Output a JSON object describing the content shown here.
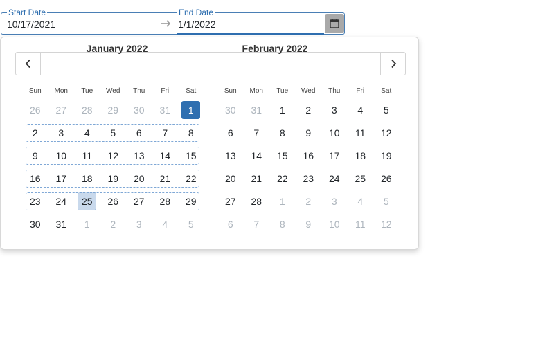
{
  "range_input": {
    "start_label": "Start Date",
    "start_value": "10/17/2021",
    "end_label": "End Date",
    "end_value": "1/1/2022"
  },
  "colors": {
    "accent": "#2f6fb0",
    "range_border": "#7fa8d6",
    "hover_fill": "#c9d9ec",
    "calendar_button": "#a9a9a9",
    "muted_day": "#adb5bd"
  },
  "icons": {
    "separator": "arrow-right-icon",
    "calendar": "calendar-icon",
    "prev": "chevron-left-icon",
    "next": "chevron-right-icon"
  },
  "calendar": {
    "weekdays": [
      "Sun",
      "Mon",
      "Tue",
      "Wed",
      "Thu",
      "Fri",
      "Sat"
    ],
    "months": [
      {
        "title": "January 2022",
        "weeks": [
          {
            "in_range": false,
            "days": [
              {
                "n": "26",
                "muted": true
              },
              {
                "n": "27",
                "muted": true
              },
              {
                "n": "28",
                "muted": true
              },
              {
                "n": "29",
                "muted": true
              },
              {
                "n": "30",
                "muted": true
              },
              {
                "n": "31",
                "muted": true
              },
              {
                "n": "1",
                "selected": true
              }
            ]
          },
          {
            "in_range": true,
            "days": [
              {
                "n": "2"
              },
              {
                "n": "3"
              },
              {
                "n": "4"
              },
              {
                "n": "5"
              },
              {
                "n": "6"
              },
              {
                "n": "7"
              },
              {
                "n": "8"
              }
            ]
          },
          {
            "in_range": true,
            "days": [
              {
                "n": "9"
              },
              {
                "n": "10"
              },
              {
                "n": "11"
              },
              {
                "n": "12"
              },
              {
                "n": "13"
              },
              {
                "n": "14"
              },
              {
                "n": "15"
              }
            ]
          },
          {
            "in_range": true,
            "days": [
              {
                "n": "16"
              },
              {
                "n": "17"
              },
              {
                "n": "18"
              },
              {
                "n": "19"
              },
              {
                "n": "20"
              },
              {
                "n": "21"
              },
              {
                "n": "22"
              }
            ]
          },
          {
            "in_range": true,
            "partial_end": 3,
            "days": [
              {
                "n": "23"
              },
              {
                "n": "24"
              },
              {
                "n": "25",
                "hover": true
              },
              {
                "n": "26"
              },
              {
                "n": "27"
              },
              {
                "n": "28"
              },
              {
                "n": "29"
              }
            ]
          },
          {
            "in_range": false,
            "days": [
              {
                "n": "30"
              },
              {
                "n": "31"
              },
              {
                "n": "1",
                "muted": true
              },
              {
                "n": "2",
                "muted": true
              },
              {
                "n": "3",
                "muted": true
              },
              {
                "n": "4",
                "muted": true
              },
              {
                "n": "5",
                "muted": true
              }
            ]
          }
        ]
      },
      {
        "title": "February 2022",
        "weeks": [
          {
            "in_range": false,
            "days": [
              {
                "n": "30",
                "muted": true
              },
              {
                "n": "31",
                "muted": true
              },
              {
                "n": "1"
              },
              {
                "n": "2"
              },
              {
                "n": "3"
              },
              {
                "n": "4"
              },
              {
                "n": "5"
              }
            ]
          },
          {
            "in_range": false,
            "days": [
              {
                "n": "6"
              },
              {
                "n": "7"
              },
              {
                "n": "8"
              },
              {
                "n": "9"
              },
              {
                "n": "10"
              },
              {
                "n": "11"
              },
              {
                "n": "12"
              }
            ]
          },
          {
            "in_range": false,
            "days": [
              {
                "n": "13"
              },
              {
                "n": "14"
              },
              {
                "n": "15"
              },
              {
                "n": "16"
              },
              {
                "n": "17"
              },
              {
                "n": "18"
              },
              {
                "n": "19"
              }
            ]
          },
          {
            "in_range": false,
            "days": [
              {
                "n": "20"
              },
              {
                "n": "21"
              },
              {
                "n": "22"
              },
              {
                "n": "23"
              },
              {
                "n": "24"
              },
              {
                "n": "25"
              },
              {
                "n": "26"
              }
            ]
          },
          {
            "in_range": false,
            "days": [
              {
                "n": "27"
              },
              {
                "n": "28"
              },
              {
                "n": "1",
                "muted": true
              },
              {
                "n": "2",
                "muted": true
              },
              {
                "n": "3",
                "muted": true
              },
              {
                "n": "4",
                "muted": true
              },
              {
                "n": "5",
                "muted": true
              }
            ]
          },
          {
            "in_range": false,
            "days": [
              {
                "n": "6",
                "muted": true
              },
              {
                "n": "7",
                "muted": true
              },
              {
                "n": "8",
                "muted": true
              },
              {
                "n": "9",
                "muted": true
              },
              {
                "n": "10",
                "muted": true
              },
              {
                "n": "11",
                "muted": true
              },
              {
                "n": "12",
                "muted": true
              }
            ]
          }
        ]
      }
    ]
  }
}
